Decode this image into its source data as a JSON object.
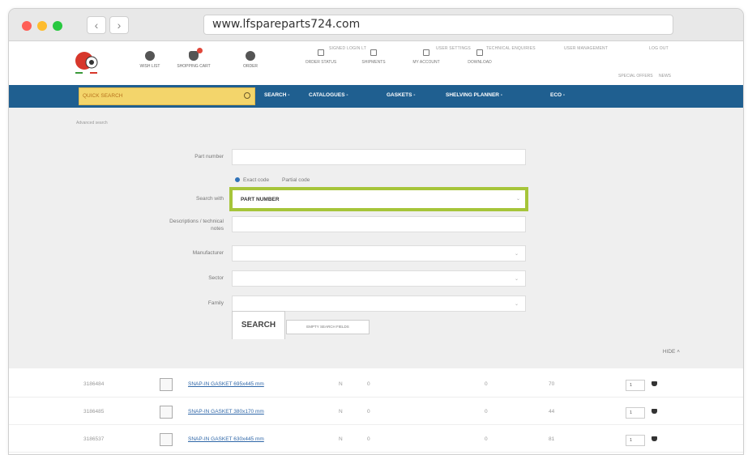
{
  "browser": {
    "url": "www.lfspareparts724.com"
  },
  "header": {
    "top_links": {
      "login": "SIGNED LOGIN LT",
      "items": [
        "USER SETTINGS",
        "TECHNICAL ENQUIRIES",
        "USER MANAGEMENT",
        "LOG OUT"
      ]
    },
    "icons": [
      {
        "label": "WISH LIST",
        "icon": "circle-icon"
      },
      {
        "label": "SHOPPING CART",
        "icon": "cart-icon"
      },
      {
        "label": "ORDER",
        "icon": "circle-icon"
      }
    ],
    "icons2": [
      {
        "label": "ORDER STATUS",
        "icon": "doc-icon"
      },
      {
        "label": "SHIPMENTS",
        "icon": "truck-icon"
      },
      {
        "label": "MY ACCOUNT",
        "icon": "calendar-icon"
      },
      {
        "label": "DOWNLOAD",
        "icon": "download-icon"
      }
    ],
    "special": [
      "SPECIAL OFFERS",
      "NEWS"
    ]
  },
  "nav": {
    "quick_search": "QUICK SEARCH",
    "items": [
      "SEARCH -",
      "CATALOGUES -",
      "GASKETS -",
      "SHELVING PLANNER -",
      "ECO -"
    ]
  },
  "search": {
    "breadcrumb": "Advanced search",
    "labels": {
      "part_number": "Part number",
      "search_with": "Search with",
      "descriptions": "Descriptions / technical notes",
      "manufacturer": "Manufacturer",
      "sector": "Sector",
      "family": "Family"
    },
    "radio": {
      "exact": "Exact code",
      "partial": "Partial code"
    },
    "search_with_value": "PART NUMBER",
    "search_button": "SEARCH",
    "empty_button": "EMPTY SEARCH FIELDS",
    "hide": "HIDE"
  },
  "results": [
    {
      "code": "3186484",
      "desc": "SNAP-IN GASKET 695x445 mm",
      "a": "N",
      "b": "0",
      "c": "0",
      "d": "70",
      "qty": "1"
    },
    {
      "code": "3186485",
      "desc": "SNAP-IN GASKET 380x170 mm",
      "a": "N",
      "b": "0",
      "c": "0",
      "d": "44",
      "qty": "1"
    },
    {
      "code": "3186537",
      "desc": "SNAP-IN GASKET 630x445 mm",
      "a": "N",
      "b": "0",
      "c": "0",
      "d": "81",
      "qty": "1"
    }
  ]
}
